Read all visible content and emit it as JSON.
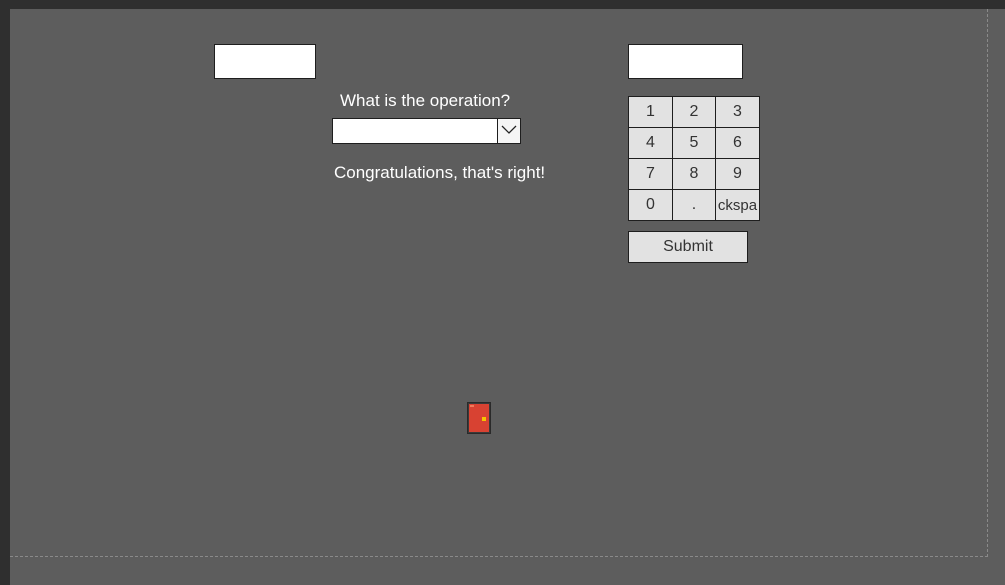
{
  "operation": {
    "question": "What is the operation?",
    "selected": ""
  },
  "inputs": {
    "left_value": "",
    "right_value": ""
  },
  "feedback": "Congratulations, that's right!",
  "keypad": {
    "keys": [
      "1",
      "2",
      "3",
      "4",
      "5",
      "6",
      "7",
      "8",
      "9",
      "0",
      ".",
      "ckspa"
    ]
  },
  "submit_label": "Submit",
  "icons": {
    "door": "door-icon",
    "dropdown": "chevron-down-icon"
  },
  "colors": {
    "background": "#5d5d5d",
    "key_face": "#e2e2e2",
    "door_red": "#d84232",
    "door_knob": "#f5c400"
  }
}
